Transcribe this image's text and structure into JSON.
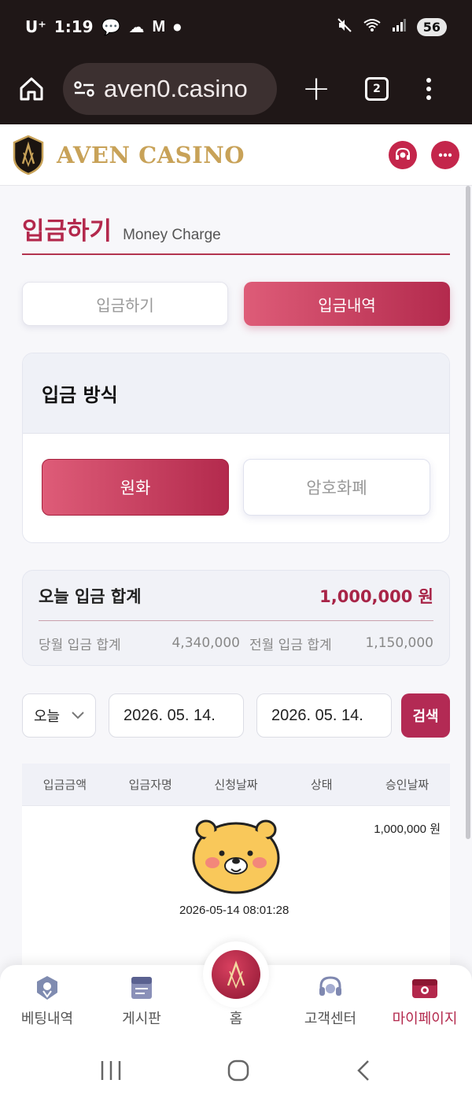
{
  "status": {
    "carrier": "U⁺",
    "time": "1:19",
    "battery": "56"
  },
  "browser": {
    "url": "aven0.casino",
    "tab_count": "2"
  },
  "header": {
    "logo_text": "AVEN CASINO"
  },
  "page": {
    "title": "입금하기",
    "subtitle": "Money Charge"
  },
  "tabs": [
    {
      "label": "입금하기"
    },
    {
      "label": "입금내역"
    }
  ],
  "method": {
    "title": "입금 방식",
    "options": [
      {
        "label": "원화"
      },
      {
        "label": "암호화폐"
      }
    ]
  },
  "summary": {
    "today_label": "오늘 입금 합계",
    "today_value": "1,000,000 원",
    "month_label": "당월 입금 합계",
    "month_value": "4,340,000",
    "prev_label": "전월 입금 합계",
    "prev_value": "1,150,000"
  },
  "filters": {
    "period": "오늘",
    "date_from": "2026. 05. 14.",
    "date_to": "2026. 05. 14.",
    "search_label": "검색"
  },
  "table": {
    "headers": [
      "입금금액",
      "입금자명",
      "신청날짜",
      "상태",
      "승인날짜"
    ],
    "row": {
      "amount": "1,000,000 원",
      "date": "2026-05-14 08:01:28"
    }
  },
  "bottom_nav": [
    {
      "label": "베팅내역",
      "icon": "badge-icon"
    },
    {
      "label": "게시판",
      "icon": "board-icon"
    },
    {
      "label": "홈",
      "icon": "home-logo-icon"
    },
    {
      "label": "고객센터",
      "icon": "headset-icon"
    },
    {
      "label": "마이페이지",
      "icon": "wallet-icon"
    }
  ],
  "colors": {
    "accent": "#b3284c",
    "gold": "#c8a258"
  }
}
